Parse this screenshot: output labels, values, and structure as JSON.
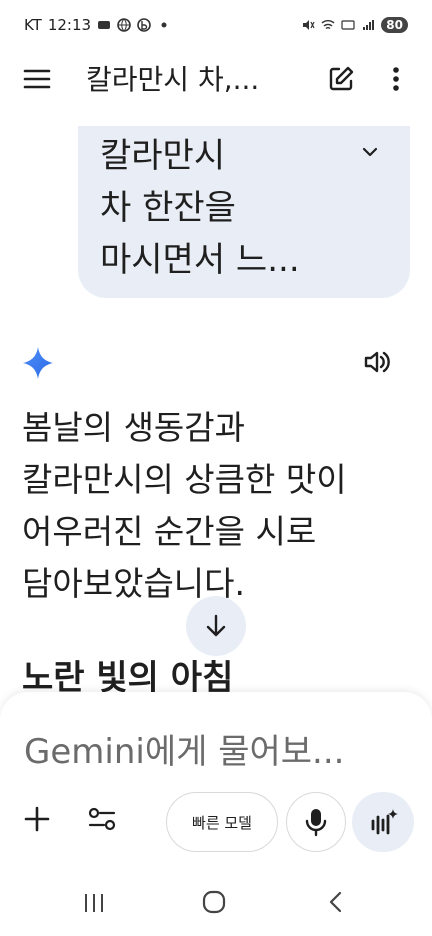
{
  "status": {
    "carrier": "KT",
    "time": "12:13",
    "battery": "80"
  },
  "appbar": {
    "title": "칼라만시 차,..."
  },
  "user_message": {
    "lines": [
      "칼라만시",
      "차 한잔을",
      "마시면서 느..."
    ]
  },
  "response": {
    "lines": [
      "봄날의 생동감과",
      "칼라만시의 상큼한 맛이",
      "어우러진 순간을 시로",
      "담아보았습니다."
    ],
    "heading": "노란 빛의 아침"
  },
  "input": {
    "placeholder": "Gemini에게 물어보..."
  },
  "toolbar": {
    "model_label": "빠른 모델"
  },
  "colors": {
    "accent": "#4285f4",
    "bubble": "#e9eef6"
  }
}
